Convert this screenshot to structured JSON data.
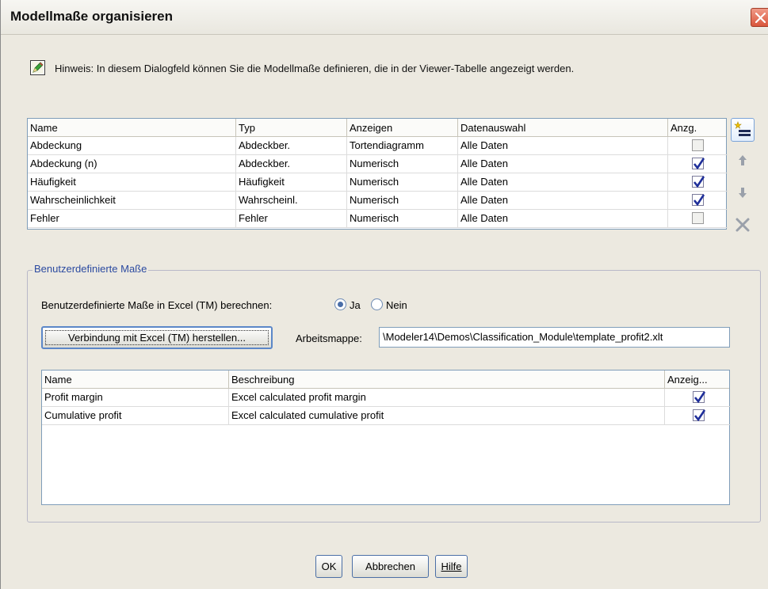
{
  "window": {
    "title": "Modellmaße organisieren"
  },
  "hint": {
    "text": "Hinweis: In diesem Dialogfeld können Sie die Modellmaße definieren, die in der Viewer-Tabelle angezeigt werden."
  },
  "measures_table": {
    "columns": [
      "Name",
      "Typ",
      "Anzeigen",
      "Datenauswahl",
      "Anzg."
    ],
    "rows": [
      {
        "name": "Abdeckung",
        "type": "Abdeckber.",
        "display": "Tortendiagramm",
        "data": "Alle Daten",
        "checked": false
      },
      {
        "name": "Abdeckung (n)",
        "type": "Abdeckber.",
        "display": "Numerisch",
        "data": "Alle Daten",
        "checked": true
      },
      {
        "name": "Häufigkeit",
        "type": "Häufigkeit",
        "display": "Numerisch",
        "data": "Alle Daten",
        "checked": true
      },
      {
        "name": "Wahrscheinlichkeit",
        "type": "Wahrscheinl.",
        "display": "Numerisch",
        "data": "Alle Daten",
        "checked": true
      },
      {
        "name": "Fehler",
        "type": "Fehler",
        "display": "Numerisch",
        "data": "Alle Daten",
        "checked": false
      }
    ]
  },
  "side_buttons": [
    "new-row-icon",
    "arrow-up-icon",
    "arrow-down-icon",
    "delete-icon"
  ],
  "custom": {
    "group_label": "Benutzerdefinierte Maße",
    "compute_label": "Benutzerdefinierte Maße in Excel (TM) berechnen:",
    "radio_yes": "Ja",
    "radio_no": "Nein",
    "selected": "Ja",
    "connect_button": "Verbindung mit Excel (TM) herstellen...",
    "workbook_label": "Arbeitsmappe:",
    "workbook_value": "\\Modeler14\\Demos\\Classification_Module\\template_profit2.xlt",
    "columns": [
      "Name",
      "Beschreibung",
      "Anzeig..."
    ],
    "rows": [
      {
        "name": "Profit margin",
        "description": "Excel calculated profit margin",
        "checked": true
      },
      {
        "name": "Cumulative profit",
        "description": "Excel calculated cumulative profit",
        "checked": true
      }
    ]
  },
  "footer": {
    "ok": "OK",
    "cancel": "Abbrechen",
    "help": "Hilfe"
  },
  "colors": {
    "accent": "#2b4aa0",
    "check": "#1f2f9a",
    "close": "#d9563c"
  }
}
